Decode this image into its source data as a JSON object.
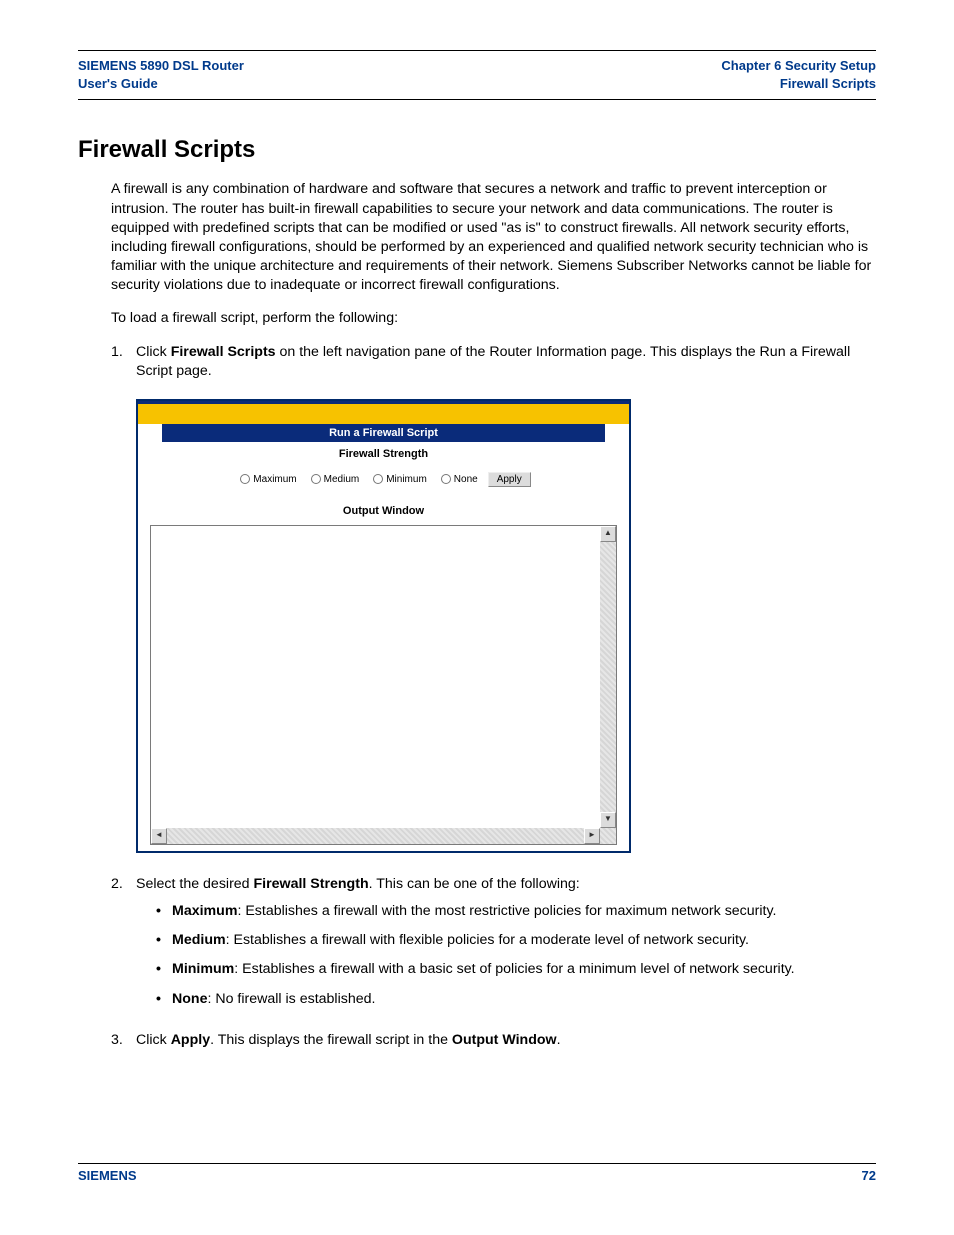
{
  "header": {
    "left_line1": "SIEMENS 5890 DSL Router",
    "left_line2": "User's Guide",
    "right_line1": "Chapter 6  Security Setup",
    "right_line2": "Firewall Scripts"
  },
  "title": "Firewall Scripts",
  "intro": "A firewall is any combination of hardware and software that secures a network and traffic to prevent interception or intrusion. The router has built-in firewall capabilities to secure your network and data communications. The router is equipped with predefined scripts that can be modified or used \"as is\" to construct firewalls. All network security efforts, including firewall configurations, should be performed by an experienced and qualified network security technician who is familiar with the unique architecture and requirements of their network. Siemens Subscriber Networks cannot be liable for security violations due to inadequate or incorrect firewall configurations.",
  "lead": "To load a firewall script, perform the following:",
  "steps": {
    "s1": {
      "num": "1.",
      "pre": "Click ",
      "bold": "Firewall Scripts",
      "post": " on the left navigation pane of the Router Information page. This displays the Run a Firewall Script page."
    },
    "s2": {
      "num": "2.",
      "pre": "Select the desired ",
      "bold": "Firewall Strength",
      "post": ". This can be one of the following:",
      "bullets": [
        {
          "label": "Maximum",
          "text": ": Establishes a firewall with the most restrictive policies for maximum network security."
        },
        {
          "label": "Medium",
          "text": ": Establishes a firewall with flexible policies for a moderate level of network security."
        },
        {
          "label": "Minimum",
          "text": ": Establishes a firewall with a basic set of policies for a minimum level of network security."
        },
        {
          "label": "None",
          "text": ": No firewall is established."
        }
      ]
    },
    "s3": {
      "num": "3.",
      "pre": "Click ",
      "bold1": "Apply",
      "mid": ". This displays the firewall script in the ",
      "bold2": "Output Window",
      "post": "."
    }
  },
  "screenshot": {
    "panel_title": "Run a Firewall Script",
    "strength_label": "Firewall Strength",
    "radios": [
      "Maximum",
      "Medium",
      "Minimum",
      "None"
    ],
    "apply": "Apply",
    "output_label": "Output Window"
  },
  "footer": {
    "brand": "SIEMENS",
    "page": "72"
  }
}
